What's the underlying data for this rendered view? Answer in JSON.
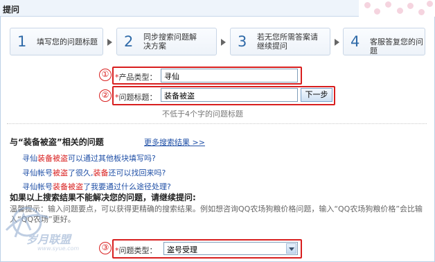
{
  "header": {
    "title": "提问"
  },
  "steps": [
    {
      "num": "1",
      "label": "填写您的问题标题"
    },
    {
      "num": "2",
      "label_line1": "同步搜索问题解",
      "label_line2": "决方案"
    },
    {
      "num": "3",
      "label_line1": "若无您所需答案请",
      "label_line2": "继续提问"
    },
    {
      "num": "4",
      "label": "客服答复您的问题"
    }
  ],
  "form": {
    "markers": [
      "①",
      "②",
      "③"
    ],
    "required_mark": "*",
    "product_type_label": "产品类型：",
    "product_type_value": "寻仙",
    "question_title_label": "问题标题：",
    "question_title_value": "装备被盗",
    "next_button": "下一步",
    "title_hint": "不低于4个字的问题标题",
    "question_type_label": "问题类型：",
    "question_type_value": "盗号受理"
  },
  "related": {
    "heading": "与“装备被盗”相关的问题",
    "more_link": "更多搜索结果 >>",
    "items": [
      {
        "pre": "寻仙",
        "hl": "装备被盗",
        "post": "可以通过其他板块填写吗?"
      },
      {
        "pre": "寻仙帐号",
        "hl": "被盗",
        "post": "了很久,",
        "hl2": "装备",
        "post2": "还可以找回来吗?"
      },
      {
        "pre": "寻仙帐号",
        "hl": "装备被盗",
        "post": "了我要通过什么途径处理?"
      }
    ]
  },
  "continue": {
    "heading": "如果以上搜索结果不能解决您的问题，请继续提问:",
    "tip_line1": "温馨提示：输入问题要点，可以获得更精确的搜索结果。例如想咨询QQ农场狗粮价格问题，输入“QQ农场狗粮价格”会比输",
    "tip_line2": "入“QQ农场”更好。"
  },
  "watermark": {
    "text": "岁月联盟",
    "sub": "www.syue.com"
  }
}
